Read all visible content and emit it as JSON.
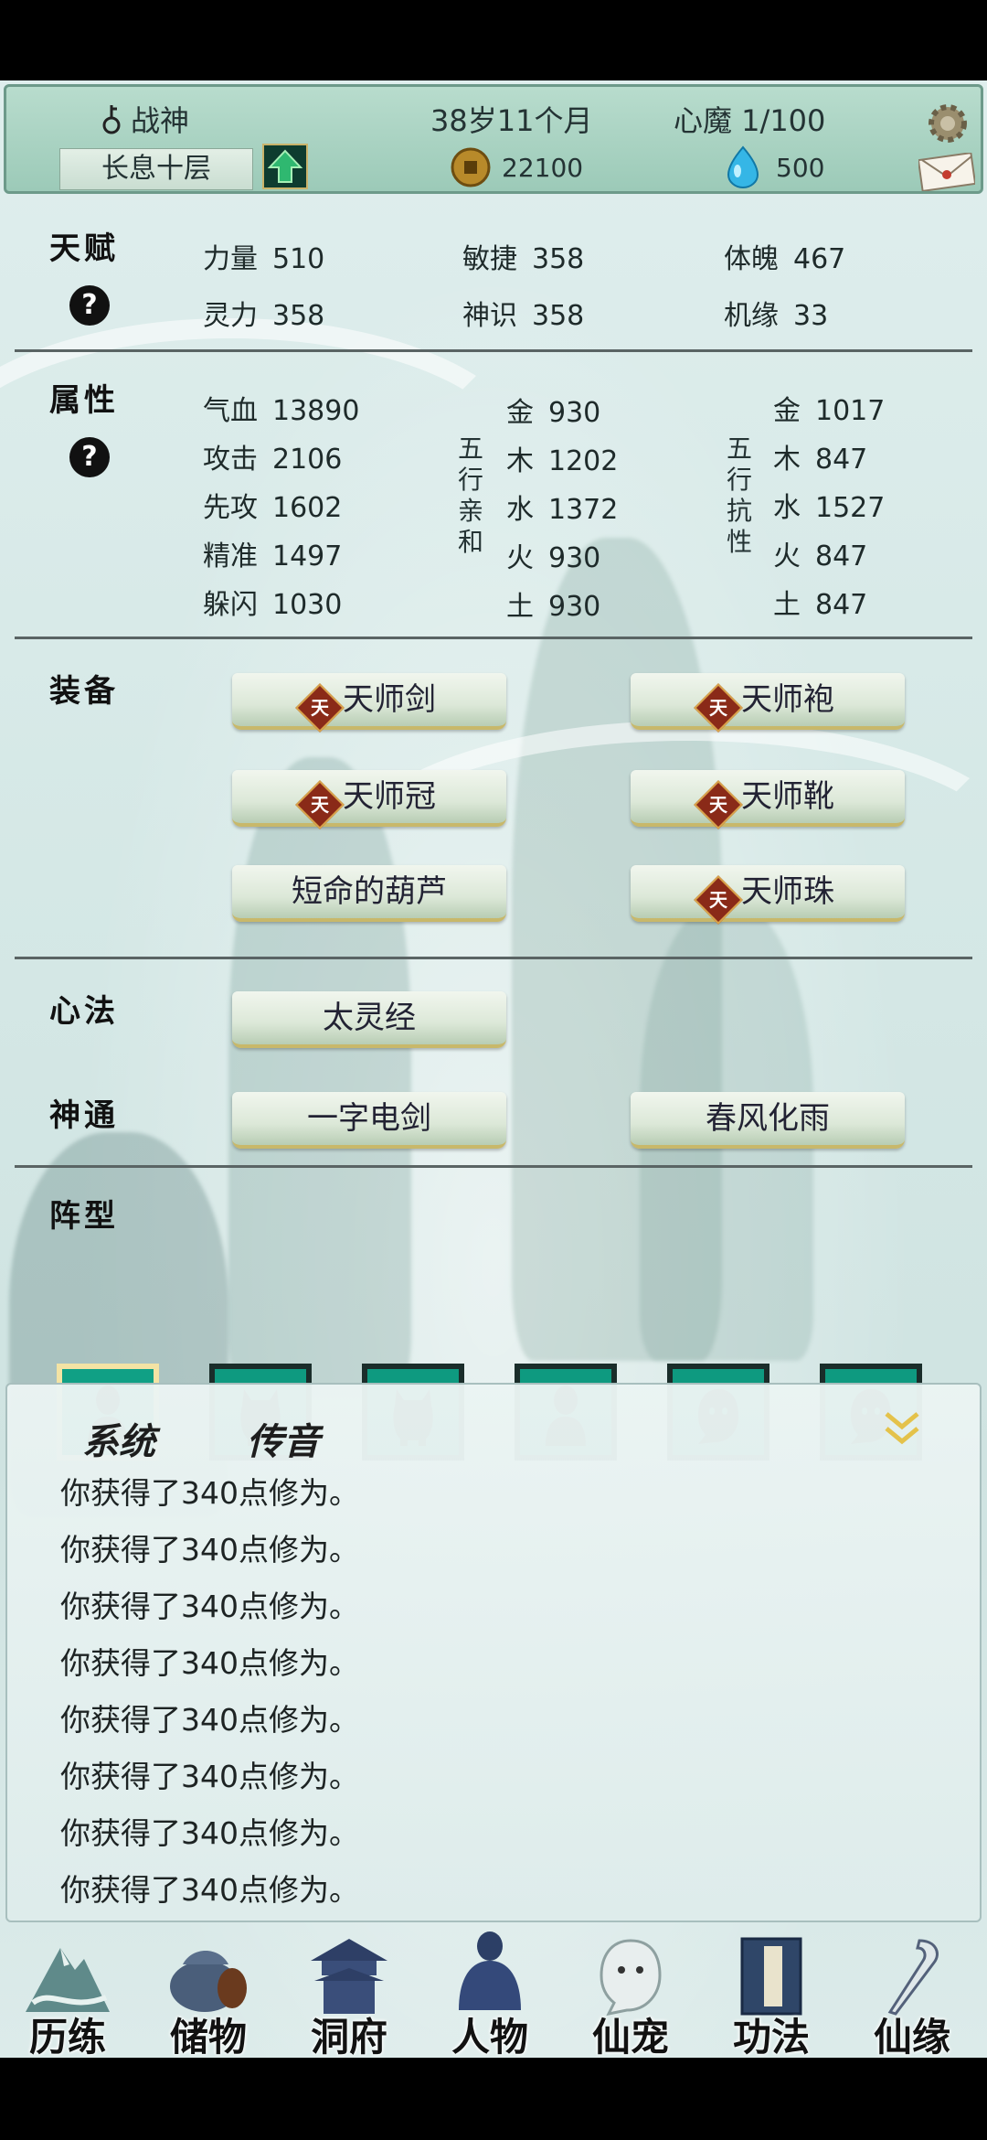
{
  "header": {
    "title": "战神",
    "age": "38岁11个月",
    "heart_demon": "心魔 1/100",
    "realm": "长息十层",
    "coins": "22100",
    "gems": "500"
  },
  "talent": {
    "title": "天赋",
    "help": "?",
    "stats": [
      {
        "label": "力量",
        "value": "510"
      },
      {
        "label": "敏捷",
        "value": "358"
      },
      {
        "label": "体魄",
        "value": "467"
      },
      {
        "label": "灵力",
        "value": "358"
      },
      {
        "label": "神识",
        "value": "358"
      },
      {
        "label": "机缘",
        "value": "33"
      }
    ]
  },
  "attributes": {
    "title": "属性",
    "help": "?",
    "base": [
      {
        "label": "气血",
        "value": "13890"
      },
      {
        "label": "攻击",
        "value": "2106"
      },
      {
        "label": "先攻",
        "value": "1602"
      },
      {
        "label": "精准",
        "value": "1497"
      },
      {
        "label": "躲闪",
        "value": "1030"
      }
    ],
    "affinity_label": [
      "五",
      "行",
      "亲",
      "和"
    ],
    "affinity": [
      {
        "label": "金",
        "value": "930"
      },
      {
        "label": "木",
        "value": "1202"
      },
      {
        "label": "水",
        "value": "1372"
      },
      {
        "label": "火",
        "value": "930"
      },
      {
        "label": "土",
        "value": "930"
      }
    ],
    "resist_label": [
      "五",
      "行",
      "抗",
      "性"
    ],
    "resist": [
      {
        "label": "金",
        "value": "1017"
      },
      {
        "label": "木",
        "value": "847"
      },
      {
        "label": "水",
        "value": "1527"
      },
      {
        "label": "火",
        "value": "847"
      },
      {
        "label": "土",
        "value": "847"
      }
    ]
  },
  "equipment": {
    "title": "装备",
    "badge": "天",
    "items": [
      "天师剑",
      "天师袍",
      "天师冠",
      "天师靴",
      "短命的葫芦",
      "天师珠"
    ]
  },
  "mind": {
    "title": "心法",
    "item": "太灵经"
  },
  "skills": {
    "title": "神通",
    "items": [
      "一字电剑",
      "春风化雨"
    ]
  },
  "formation": {
    "title": "阵型"
  },
  "messages": {
    "tabs": [
      "系统",
      "传音"
    ],
    "lines": [
      "你获得了340点修为。",
      "你获得了340点修为。",
      "你获得了340点修为。",
      "你获得了340点修为。",
      "你获得了340点修为。",
      "你获得了340点修为。",
      "你获得了340点修为。",
      "你获得了340点修为。"
    ]
  },
  "nav": [
    "历练",
    "储物",
    "洞府",
    "人物",
    "仙宠",
    "功法",
    "仙缘"
  ]
}
